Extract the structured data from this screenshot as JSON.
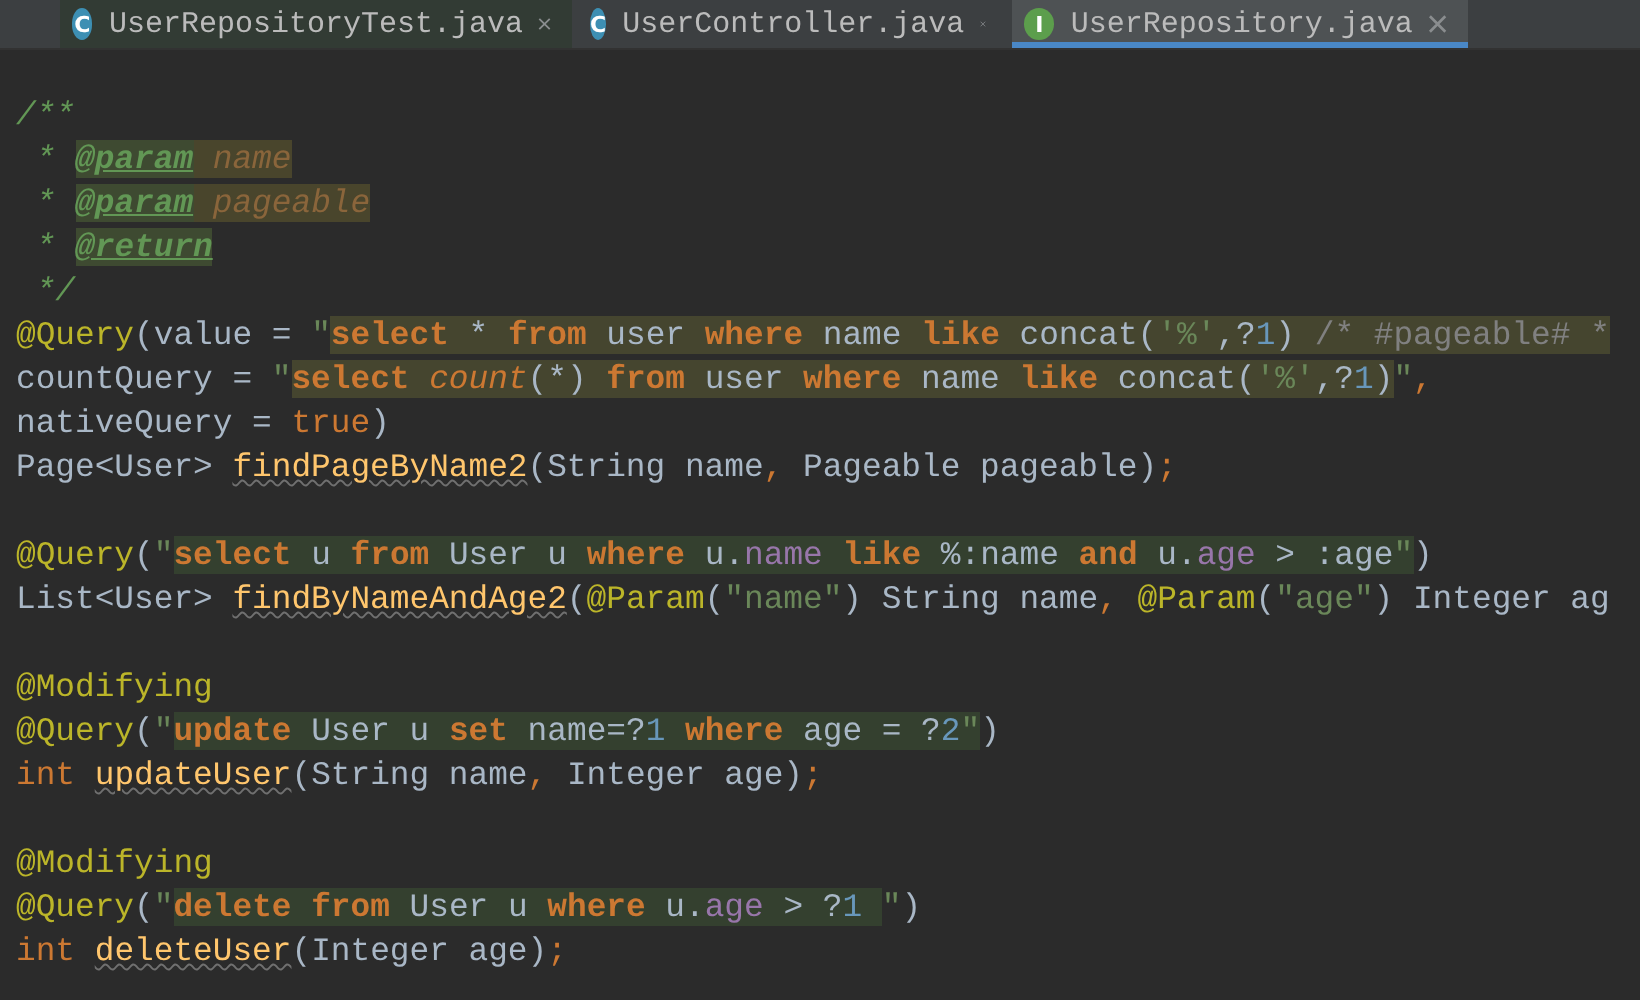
{
  "tabs": [
    {
      "title": "UserRepositoryTest.java",
      "icon_letter": "C",
      "kind": "class",
      "selected": false
    },
    {
      "title": "UserController.java",
      "icon_letter": "C",
      "kind": "class",
      "selected": false
    },
    {
      "title": "UserRepository.java",
      "icon_letter": "I",
      "kind": "interface",
      "selected": true
    }
  ],
  "editor": {
    "blocks": [
      [
        {
          "segments": [
            {
              "kind": "plain",
              "tokens": [
                {
                  "text": "/**",
                  "kind": "comment"
                }
              ]
            }
          ]
        },
        {
          "segments": [
            {
              "kind": "plain",
              "tokens": [
                {
                  "text": " * ",
                  "kind": "comment"
                },
                {
                  "text": "@param",
                  "kind": "doc-tag"
                },
                {
                  "text": " name",
                  "kind": "doc-param"
                }
              ]
            }
          ]
        },
        {
          "segments": [
            {
              "kind": "plain",
              "tokens": [
                {
                  "text": " * ",
                  "kind": "comment"
                },
                {
                  "text": "@param",
                  "kind": "doc-tag"
                },
                {
                  "text": " pageable",
                  "kind": "doc-param"
                }
              ]
            }
          ]
        },
        {
          "segments": [
            {
              "kind": "plain",
              "tokens": [
                {
                  "text": " * ",
                  "kind": "comment"
                },
                {
                  "text": "@return",
                  "kind": "doc-tag"
                }
              ]
            }
          ]
        },
        {
          "segments": [
            {
              "kind": "plain",
              "tokens": [
                {
                  "text": " */",
                  "kind": "comment"
                }
              ]
            }
          ]
        },
        {
          "segments": [
            {
              "kind": "plain",
              "tokens": [
                {
                  "text": "@Query",
                  "kind": "annotation"
                },
                {
                  "text": "(value = ",
                  "kind": "plain"
                },
                {
                  "text": "\"",
                  "kind": "string"
                }
              ]
            },
            {
              "kind": "native-sql",
              "tokens": [
                {
                  "text": "select",
                  "kind": "sql-keyword"
                },
                {
                  "text": " * ",
                  "kind": "plain"
                },
                {
                  "text": "from",
                  "kind": "sql-keyword"
                },
                {
                  "text": " user ",
                  "kind": "plain"
                },
                {
                  "text": "where",
                  "kind": "sql-keyword"
                },
                {
                  "text": " name ",
                  "kind": "plain"
                },
                {
                  "text": "like",
                  "kind": "sql-keyword"
                },
                {
                  "text": " concat(",
                  "kind": "plain"
                },
                {
                  "text": "'%'",
                  "kind": "string"
                },
                {
                  "text": ",?",
                  "kind": "plain"
                },
                {
                  "text": "1",
                  "kind": "number"
                },
                {
                  "text": ") ",
                  "kind": "plain"
                },
                {
                  "text": "/* #pageable# *",
                  "kind": "sql-comment"
                }
              ]
            }
          ]
        },
        {
          "segments": [
            {
              "kind": "plain",
              "tokens": [
                {
                  "text": "countQuery = ",
                  "kind": "plain"
                },
                {
                  "text": "\"",
                  "kind": "string"
                }
              ]
            },
            {
              "kind": "native-sql",
              "tokens": [
                {
                  "text": "select ",
                  "kind": "sql-keyword"
                },
                {
                  "text": "count",
                  "kind": "sql-function"
                },
                {
                  "text": "(*) ",
                  "kind": "plain"
                },
                {
                  "text": "from",
                  "kind": "sql-keyword"
                },
                {
                  "text": " user ",
                  "kind": "plain"
                },
                {
                  "text": "where",
                  "kind": "sql-keyword"
                },
                {
                  "text": " name ",
                  "kind": "plain"
                },
                {
                  "text": "like",
                  "kind": "sql-keyword"
                },
                {
                  "text": " concat(",
                  "kind": "plain"
                },
                {
                  "text": "'%'",
                  "kind": "string"
                },
                {
                  "text": ",?",
                  "kind": "plain"
                },
                {
                  "text": "1",
                  "kind": "number"
                },
                {
                  "text": ")",
                  "kind": "plain"
                }
              ]
            },
            {
              "kind": "plain",
              "tokens": [
                {
                  "text": "\"",
                  "kind": "string"
                },
                {
                  "text": ",",
                  "kind": "separator"
                }
              ]
            }
          ]
        },
        {
          "segments": [
            {
              "kind": "plain",
              "tokens": [
                {
                  "text": "nativeQuery = ",
                  "kind": "plain"
                },
                {
                  "text": "true",
                  "kind": "java-keyword"
                },
                {
                  "text": ")",
                  "kind": "plain"
                }
              ]
            }
          ]
        },
        {
          "segments": [
            {
              "kind": "plain",
              "tokens": [
                {
                  "text": "Page<User> ",
                  "kind": "plain"
                },
                {
                  "text": "findPageByName2",
                  "kind": "method"
                },
                {
                  "text": "(String name",
                  "kind": "plain"
                },
                {
                  "text": ",",
                  "kind": "separator"
                },
                {
                  "text": " Pageable pageable)",
                  "kind": "plain"
                },
                {
                  "text": ";",
                  "kind": "separator"
                }
              ]
            }
          ]
        }
      ],
      [
        {
          "segments": [
            {
              "kind": "plain",
              "tokens": [
                {
                  "text": "@Query",
                  "kind": "annotation"
                },
                {
                  "text": "(",
                  "kind": "plain"
                },
                {
                  "text": "\"",
                  "kind": "string"
                }
              ]
            },
            {
              "kind": "jpql",
              "tokens": [
                {
                  "text": "select",
                  "kind": "sql-keyword"
                },
                {
                  "text": " u ",
                  "kind": "plain"
                },
                {
                  "text": "from",
                  "kind": "sql-keyword"
                },
                {
                  "text": " User u ",
                  "kind": "plain"
                },
                {
                  "text": "where",
                  "kind": "sql-keyword"
                },
                {
                  "text": " u.",
                  "kind": "plain"
                },
                {
                  "text": "name",
                  "kind": "field"
                },
                {
                  "text": " like",
                  "kind": "sql-keyword"
                },
                {
                  "text": " %:name ",
                  "kind": "plain"
                },
                {
                  "text": "and",
                  "kind": "sql-keyword"
                },
                {
                  "text": " u.",
                  "kind": "plain"
                },
                {
                  "text": "age",
                  "kind": "field"
                },
                {
                  "text": " > :age",
                  "kind": "plain"
                },
                {
                  "text": "\"",
                  "kind": "string"
                }
              ]
            },
            {
              "kind": "plain",
              "tokens": [
                {
                  "text": ")",
                  "kind": "plain"
                }
              ]
            }
          ]
        },
        {
          "segments": [
            {
              "kind": "plain",
              "tokens": [
                {
                  "text": "List<User> ",
                  "kind": "plain"
                },
                {
                  "text": "findByNameAndAge2",
                  "kind": "method"
                },
                {
                  "text": "(",
                  "kind": "plain"
                },
                {
                  "text": "@Param",
                  "kind": "annotation"
                },
                {
                  "text": "(",
                  "kind": "plain"
                },
                {
                  "text": "\"name\"",
                  "kind": "string"
                },
                {
                  "text": ") String name",
                  "kind": "plain"
                },
                {
                  "text": ", ",
                  "kind": "separator"
                },
                {
                  "text": "@Param",
                  "kind": "annotation"
                },
                {
                  "text": "(",
                  "kind": "plain"
                },
                {
                  "text": "\"age\"",
                  "kind": "string"
                },
                {
                  "text": ") Integer ag",
                  "kind": "plain"
                }
              ]
            }
          ]
        }
      ],
      [
        {
          "segments": [
            {
              "kind": "plain",
              "tokens": [
                {
                  "text": "@Modifying",
                  "kind": "annotation"
                }
              ]
            }
          ]
        },
        {
          "segments": [
            {
              "kind": "plain",
              "tokens": [
                {
                  "text": "@Query",
                  "kind": "annotation"
                },
                {
                  "text": "(",
                  "kind": "plain"
                },
                {
                  "text": "\"",
                  "kind": "string"
                }
              ]
            },
            {
              "kind": "jpql",
              "tokens": [
                {
                  "text": "update",
                  "kind": "sql-keyword"
                },
                {
                  "text": " User u ",
                  "kind": "plain"
                },
                {
                  "text": "set",
                  "kind": "sql-keyword"
                },
                {
                  "text": " name=?",
                  "kind": "plain"
                },
                {
                  "text": "1",
                  "kind": "number"
                },
                {
                  "text": " where",
                  "kind": "sql-keyword"
                },
                {
                  "text": " age = ?",
                  "kind": "plain"
                },
                {
                  "text": "2",
                  "kind": "number"
                },
                {
                  "text": "\"",
                  "kind": "string"
                }
              ]
            },
            {
              "kind": "plain",
              "tokens": [
                {
                  "text": ")",
                  "kind": "plain"
                }
              ]
            }
          ]
        },
        {
          "segments": [
            {
              "kind": "plain",
              "tokens": [
                {
                  "text": "int ",
                  "kind": "java-keyword"
                },
                {
                  "text": "updateUser",
                  "kind": "method"
                },
                {
                  "text": "(String name",
                  "kind": "plain"
                },
                {
                  "text": ",",
                  "kind": "separator"
                },
                {
                  "text": " Integer age)",
                  "kind": "plain"
                },
                {
                  "text": ";",
                  "kind": "separator"
                }
              ]
            }
          ]
        }
      ],
      [
        {
          "segments": [
            {
              "kind": "plain",
              "tokens": [
                {
                  "text": "@Modifying",
                  "kind": "annotation"
                }
              ]
            }
          ]
        },
        {
          "segments": [
            {
              "kind": "plain",
              "tokens": [
                {
                  "text": "@Query",
                  "kind": "annotation"
                },
                {
                  "text": "(",
                  "kind": "plain"
                },
                {
                  "text": "\"",
                  "kind": "string"
                }
              ]
            },
            {
              "kind": "jpql",
              "tokens": [
                {
                  "text": "delete ",
                  "kind": "sql-keyword"
                },
                {
                  "text": "from",
                  "kind": "sql-keyword"
                },
                {
                  "text": " User u ",
                  "kind": "plain"
                },
                {
                  "text": "where",
                  "kind": "sql-keyword"
                },
                {
                  "text": " u.",
                  "kind": "plain"
                },
                {
                  "text": "age",
                  "kind": "field"
                },
                {
                  "text": " > ?",
                  "kind": "plain"
                },
                {
                  "text": "1 ",
                  "kind": "number"
                }
              ]
            },
            {
              "kind": "plain",
              "tokens": [
                {
                  "text": "\"",
                  "kind": "string"
                },
                {
                  "text": ")",
                  "kind": "plain"
                }
              ]
            }
          ]
        },
        {
          "segments": [
            {
              "kind": "plain",
              "tokens": [
                {
                  "text": "int ",
                  "kind": "java-keyword"
                },
                {
                  "text": "deleteUser",
                  "kind": "method"
                },
                {
                  "text": "(Integer age)",
                  "kind": "plain"
                },
                {
                  "text": ";",
                  "kind": "separator"
                }
              ]
            }
          ]
        }
      ]
    ]
  }
}
